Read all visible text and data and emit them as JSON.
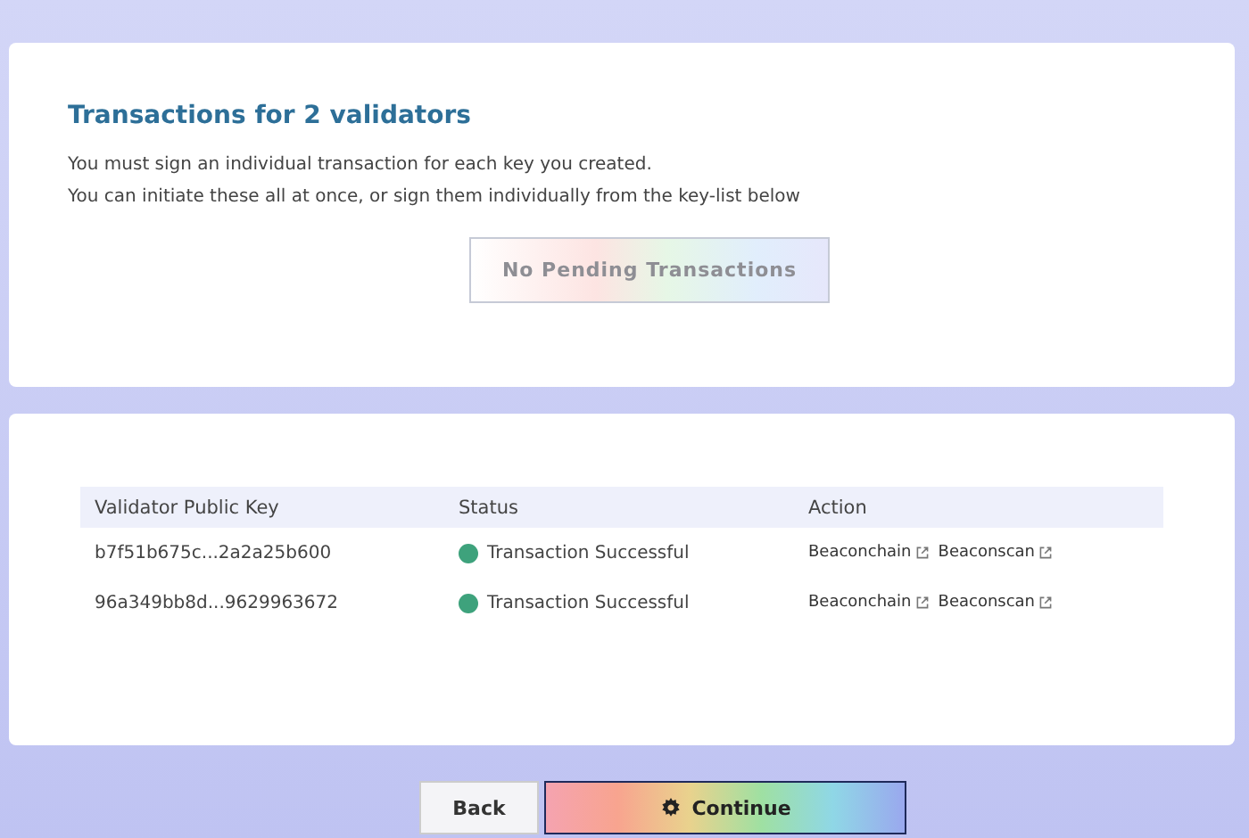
{
  "intro": {
    "title": "Transactions for 2 validators",
    "lines": [
      "You must sign an individual transaction for each key you created.",
      "You can initiate these all at once, or sign them individually from the key-list below"
    ],
    "button": {
      "label": "No Pending Transactions",
      "disabled": true
    }
  },
  "table": {
    "columns": [
      "Validator Public Key",
      "Status",
      "Action"
    ],
    "rows": [
      {
        "key": "b7f51b675c...2a2a25b600",
        "status": "Transaction Successful",
        "color": "#3ea27c",
        "links": [
          "Beaconchain",
          "Beaconscan"
        ]
      },
      {
        "key": "96a349bb8d...9629963672",
        "status": "Transaction Successful",
        "color": "#3ea27c",
        "links": [
          "Beaconchain",
          "Beaconscan"
        ]
      }
    ]
  },
  "buttons": {
    "back": "Back",
    "continue": "Continue"
  }
}
